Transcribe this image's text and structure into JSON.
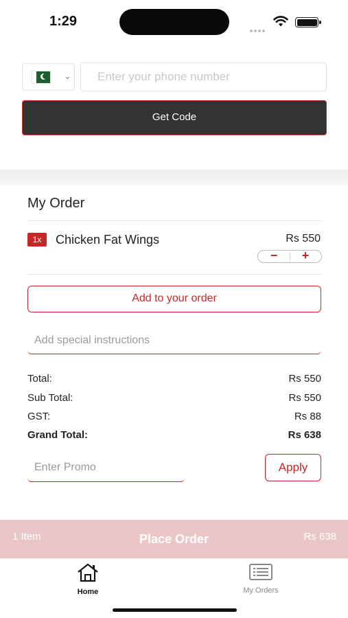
{
  "status": {
    "time": "1:29"
  },
  "login": {
    "country_flag": "pakistan-flag",
    "phone_placeholder": "Enter your phone number",
    "get_code_label": "Get Code"
  },
  "order": {
    "title": "My Order",
    "items": [
      {
        "qty": "1x",
        "name": "Chicken Fat Wings",
        "price": "Rs 550",
        "minus": "−",
        "plus": "+"
      }
    ],
    "add_label": "Add to your order",
    "special_placeholder": "Add special instructions",
    "totals": {
      "total_label": "Total:",
      "total_value": "Rs 550",
      "subtotal_label": "Sub Total:",
      "subtotal_value": "Rs 550",
      "gst_label": "GST:",
      "gst_value": "Rs 88",
      "grand_label": "Grand Total:",
      "grand_value": "Rs 638"
    },
    "promo_placeholder": "Enter Promo",
    "apply_label": "Apply"
  },
  "place_order": {
    "count": "1 Item",
    "label": "Place Order",
    "total": "Rs 638"
  },
  "tabs": [
    {
      "label": "Home",
      "icon": "home-icon",
      "active": true
    },
    {
      "label": "My Orders",
      "icon": "orders-icon",
      "active": false
    }
  ],
  "colors": {
    "accent": "#c62828",
    "dark_button": "#333333",
    "place_bar": "#ebc6c7"
  }
}
